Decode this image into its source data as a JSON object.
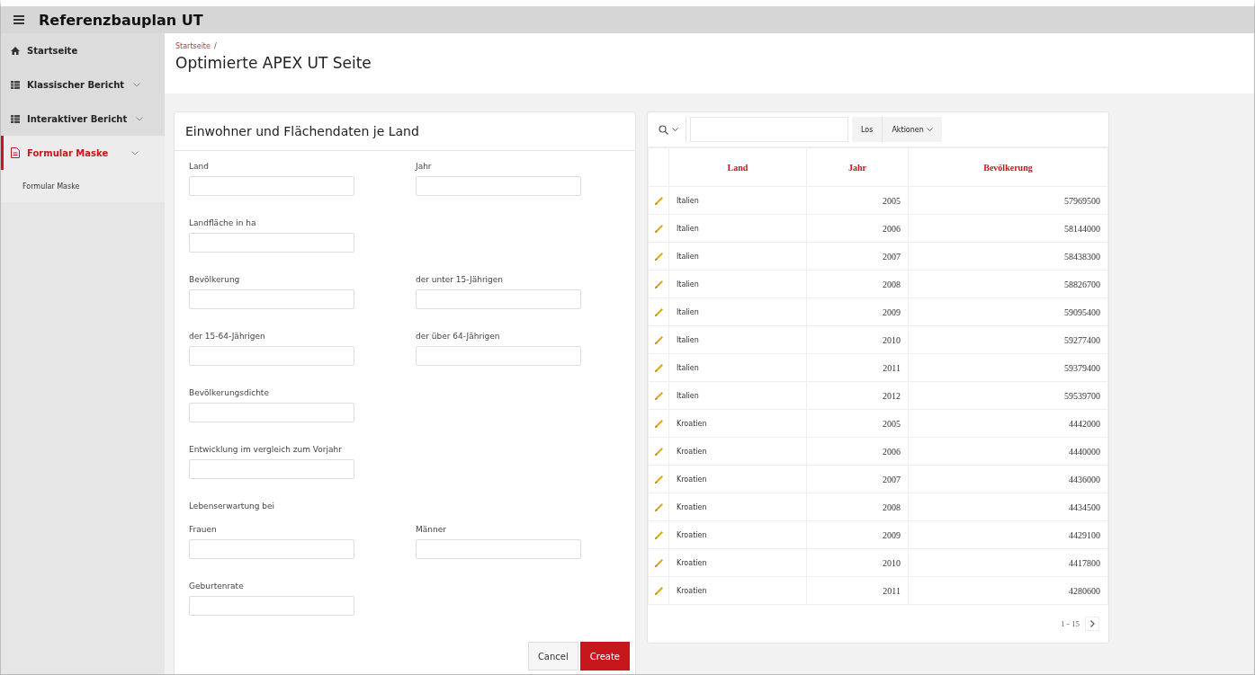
{
  "app_title": "Referenzbauplan UT",
  "sidebar": {
    "items": [
      {
        "label": "Startseite",
        "kind": "link",
        "selected": false
      },
      {
        "label": "Klassischer Bericht",
        "kind": "group",
        "selected": false
      },
      {
        "label": "Interaktiver Bericht",
        "kind": "group",
        "selected": false
      },
      {
        "label": "Formular Maske",
        "kind": "group",
        "selected": true,
        "children": [
          {
            "label": "Formular Maske",
            "selected": false
          }
        ]
      }
    ]
  },
  "breadcrumb": "Startseite",
  "breadcrumb_separator": "/",
  "page_title": "Optimierte APEX UT Seite",
  "form": {
    "title": "Einwohner und Flächendaten je Land",
    "rows": [
      {
        "kind": "fields",
        "fields": [
          "Land",
          "Jahr"
        ]
      },
      {
        "kind": "fields",
        "fields": [
          "Landfläche in ha"
        ]
      },
      {
        "kind": "fields",
        "fields": [
          "Bevölkerung",
          "der unter 15-Jährigen"
        ]
      },
      {
        "kind": "fields",
        "fields": [
          "der 15-64-Jährigen",
          "der über 64-Jährigen"
        ]
      },
      {
        "kind": "fields",
        "fields": [
          "Bevölkerungsdichte"
        ]
      },
      {
        "kind": "fields",
        "fields": [
          "Entwicklung im vergleich zum Vorjahr"
        ]
      },
      {
        "kind": "heading",
        "text": "Lebenserwartung bei"
      },
      {
        "kind": "fields",
        "fields": [
          "Frauen",
          "Männer"
        ]
      },
      {
        "kind": "fields",
        "fields": [
          "Geburtenrate"
        ]
      }
    ],
    "buttons": [
      {
        "label": "Cancel",
        "kind": "secondary"
      },
      {
        "label": "Create",
        "kind": "primary"
      }
    ]
  },
  "report": {
    "go_button": "Los",
    "actions_button": "Aktionen",
    "columns": [
      "Land",
      "Jahr",
      "Bevölkerung"
    ],
    "rows": [
      [
        "Italien",
        "2005",
        "57969500"
      ],
      [
        "Italien",
        "2006",
        "58144000"
      ],
      [
        "Italien",
        "2007",
        "58438300"
      ],
      [
        "Italien",
        "2008",
        "58826700"
      ],
      [
        "Italien",
        "2009",
        "59095400"
      ],
      [
        "Italien",
        "2010",
        "59277400"
      ],
      [
        "Italien",
        "2011",
        "59379400"
      ],
      [
        "Italien",
        "2012",
        "59539700"
      ],
      [
        "Kroatien",
        "2005",
        "4442000"
      ],
      [
        "Kroatien",
        "2006",
        "4440000"
      ],
      [
        "Kroatien",
        "2007",
        "4436000"
      ],
      [
        "Kroatien",
        "2008",
        "4434500"
      ],
      [
        "Kroatien",
        "2009",
        "4429100"
      ],
      [
        "Kroatien",
        "2010",
        "4417800"
      ],
      [
        "Kroatien",
        "2011",
        "4280600"
      ]
    ],
    "pagination": "1 - 15"
  }
}
